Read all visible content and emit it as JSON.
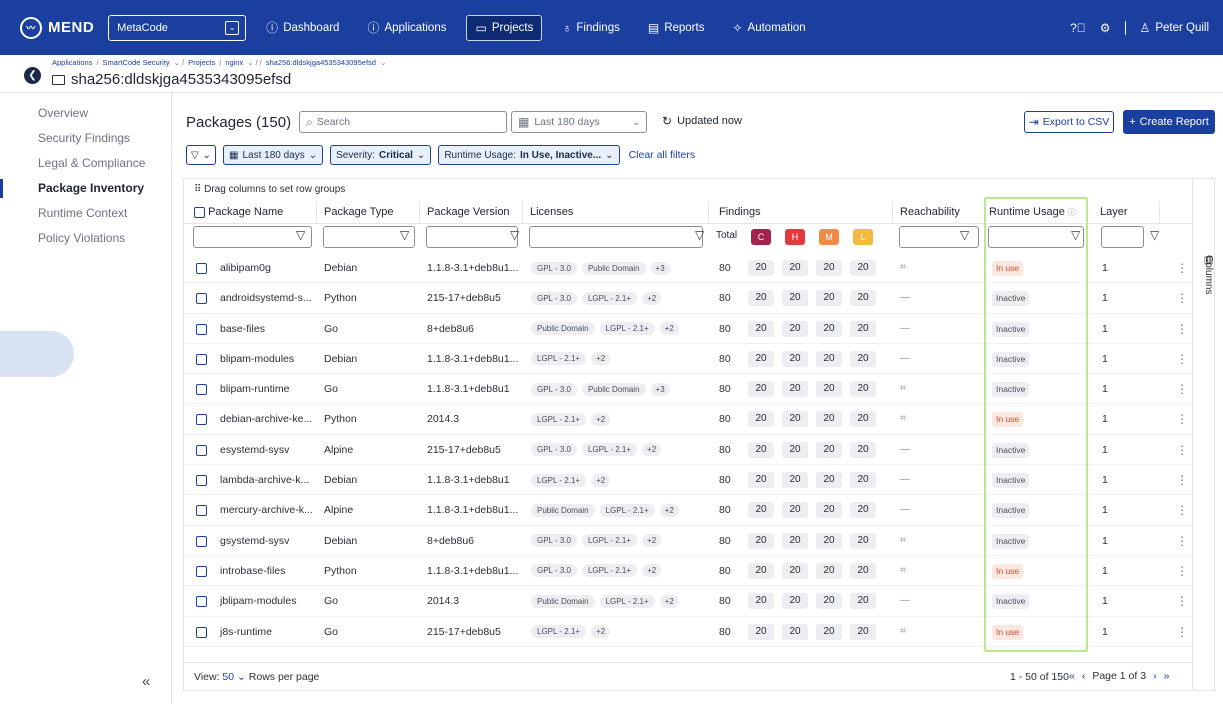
{
  "nav": {
    "logo": "MEND",
    "org": "MetaCode",
    "items": [
      {
        "label": "Dashboard",
        "icon": "info-circle-icon",
        "active": false
      },
      {
        "label": "Applications",
        "icon": "info-circle-icon",
        "active": false
      },
      {
        "label": "Projects",
        "icon": "folder-icon",
        "active": true
      },
      {
        "label": "Findings",
        "icon": "bulb-icon",
        "active": false
      },
      {
        "label": "Reports",
        "icon": "report-icon",
        "active": false
      },
      {
        "label": "Automation",
        "icon": "sparkle-icon",
        "active": false
      }
    ],
    "user": "Peter Quill"
  },
  "breadcrumb": {
    "items": [
      "Applications",
      "SmartCode Security",
      "Projects",
      "nginx",
      "sha256:dldskjga4535343095efsd"
    ],
    "title": "sha256:dldskjga4535343095efsd"
  },
  "sidebar": {
    "items": [
      {
        "label": "Overview",
        "active": false
      },
      {
        "label": "Security Findings",
        "active": false
      },
      {
        "label": "Legal & Compliance",
        "active": false
      },
      {
        "label": "Package Inventory",
        "active": true
      },
      {
        "label": "Runtime Context",
        "active": false
      },
      {
        "label": "Policy Violations",
        "active": false
      }
    ],
    "collapse": "«"
  },
  "toolbar": {
    "title": "Packages (150)",
    "search_placeholder": "Search",
    "date_range": "Last 180 days",
    "updated": "Updated now",
    "export_label": "Export to CSV",
    "create_label": "Create Report"
  },
  "filters": {
    "date": "Last 180 days",
    "severity_label": "Severity:",
    "severity_value": "Critical",
    "runtime_label": "Runtime Usage:",
    "runtime_value": "In Use, Inactive...",
    "clear": "Clear all filters"
  },
  "table": {
    "drag_hint": "Drag columns to set row groups",
    "columns_tab": "Columns",
    "headers": {
      "name": "Package Name",
      "type": "Package Type",
      "version": "Package Version",
      "licenses": "Licenses",
      "findings": "Findings",
      "reachability": "Reachability",
      "runtime": "Runtime Usage",
      "layer": "Layer"
    },
    "findings_total": "Total",
    "severity_badges": [
      {
        "label": "C",
        "color": "#a3234f"
      },
      {
        "label": "H",
        "color": "#e0393e"
      },
      {
        "label": "M",
        "color": "#f08a4b"
      },
      {
        "label": "L",
        "color": "#f4b942"
      }
    ],
    "rows": [
      {
        "name": "alibipam0g",
        "type": "Debian",
        "version": "1.1.8-3.1+deb8u1...",
        "licenses": [
          "GPL - 3.0",
          "Public Domain",
          "+3"
        ],
        "total": "80",
        "c": "20",
        "h": "20",
        "m": "20",
        "l": "20",
        "reach": "⌗",
        "runtime": "In use",
        "layer": "1"
      },
      {
        "name": "androidsystemd-s...",
        "type": "Python",
        "version": "215-17+deb8u5",
        "licenses": [
          "GPL - 3.0",
          "LGPL - 2.1+",
          "+2"
        ],
        "total": "80",
        "c": "20",
        "h": "20",
        "m": "20",
        "l": "20",
        "reach": "—",
        "runtime": "Inactive",
        "layer": "1"
      },
      {
        "name": "base-files",
        "type": "Go",
        "version": "8+deb8u6",
        "licenses": [
          "Public Domain",
          "LGPL - 2.1+",
          "+2"
        ],
        "total": "80",
        "c": "20",
        "h": "20",
        "m": "20",
        "l": "20",
        "reach": "—",
        "runtime": "Inactive",
        "layer": "1"
      },
      {
        "name": "blipam-modules",
        "type": "Debian",
        "version": "1.1.8-3.1+deb8u1...",
        "licenses": [
          "LGPL - 2.1+",
          "+2"
        ],
        "total": "80",
        "c": "20",
        "h": "20",
        "m": "20",
        "l": "20",
        "reach": "—",
        "runtime": "Inactive",
        "layer": "1"
      },
      {
        "name": "blipam-runtime",
        "type": "Go",
        "version": "1.1.8-3.1+deb8u1",
        "licenses": [
          "GPL - 3.0",
          "Public Domain",
          "+3"
        ],
        "total": "80",
        "c": "20",
        "h": "20",
        "m": "20",
        "l": "20",
        "reach": "⌗",
        "runtime": "Inactive",
        "layer": "1"
      },
      {
        "name": "debian-archive-ke...",
        "type": "Python",
        "version": "2014.3",
        "licenses": [
          "LGPL - 2.1+",
          "+2"
        ],
        "total": "80",
        "c": "20",
        "h": "20",
        "m": "20",
        "l": "20",
        "reach": "⌗",
        "runtime": "In use",
        "layer": "1"
      },
      {
        "name": "esystemd-sysv",
        "type": "Alpine",
        "version": "215-17+deb8u5",
        "licenses": [
          "GPL - 3.0",
          "LGPL - 2.1+",
          "+2"
        ],
        "total": "80",
        "c": "20",
        "h": "20",
        "m": "20",
        "l": "20",
        "reach": "—",
        "runtime": "Inactive",
        "layer": "1"
      },
      {
        "name": "lambda-archive-k...",
        "type": "Debian",
        "version": "1.1.8-3.1+deb8u1",
        "licenses": [
          "LGPL - 2.1+",
          "+2"
        ],
        "total": "80",
        "c": "20",
        "h": "20",
        "m": "20",
        "l": "20",
        "reach": "—",
        "runtime": "Inactive",
        "layer": "1"
      },
      {
        "name": "mercury-archive-k...",
        "type": "Alpine",
        "version": "1.1.8-3.1+deb8u1...",
        "licenses": [
          "Public Domain",
          "LGPL - 2.1+",
          "+2"
        ],
        "total": "80",
        "c": "20",
        "h": "20",
        "m": "20",
        "l": "20",
        "reach": "—",
        "runtime": "Inactive",
        "layer": "1"
      },
      {
        "name": "gsystemd-sysv",
        "type": "Debian",
        "version": "8+deb8u6",
        "licenses": [
          "GPL - 3.0",
          "LGPL - 2.1+",
          "+2"
        ],
        "total": "80",
        "c": "20",
        "h": "20",
        "m": "20",
        "l": "20",
        "reach": "⌗",
        "runtime": "Inactive",
        "layer": "1"
      },
      {
        "name": "introbase-files",
        "type": "Python",
        "version": "1.1.8-3.1+deb8u1...",
        "licenses": [
          "GPL - 3.0",
          "LGPL - 2.1+",
          "+2"
        ],
        "total": "80",
        "c": "20",
        "h": "20",
        "m": "20",
        "l": "20",
        "reach": "⌗",
        "runtime": "In use",
        "layer": "1"
      },
      {
        "name": "jblipam-modules",
        "type": "Go",
        "version": "2014.3",
        "licenses": [
          "Public Domain",
          "LGPL - 2.1+",
          "+2"
        ],
        "total": "80",
        "c": "20",
        "h": "20",
        "m": "20",
        "l": "20",
        "reach": "—",
        "runtime": "Inactive",
        "layer": "1"
      },
      {
        "name": "j8s-runtime",
        "type": "Go",
        "version": "215-17+deb8u5",
        "licenses": [
          "LGPL - 2.1+",
          "+2"
        ],
        "total": "80",
        "c": "20",
        "h": "20",
        "m": "20",
        "l": "20",
        "reach": "⌗",
        "runtime": "In use",
        "layer": "1"
      }
    ]
  },
  "pager": {
    "view_label": "View:",
    "page_size": "50",
    "rows_label": "Rows per page",
    "range": "1 - 50 of 150",
    "page": "Page 1 of 3"
  },
  "colors": {
    "brand": "#1b3f9f",
    "highlight": "#b9e98f",
    "in_use": "#d64d2a"
  }
}
